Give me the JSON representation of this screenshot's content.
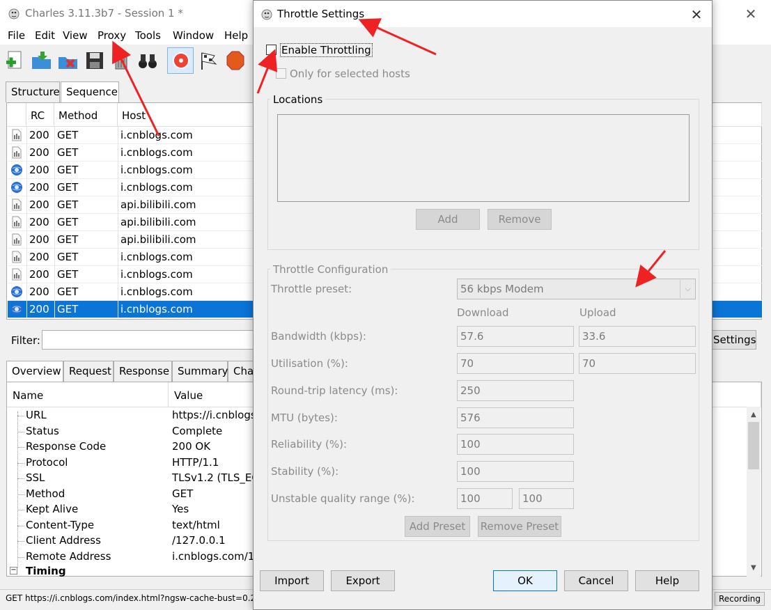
{
  "app": {
    "title": "Charles 3.11.3b7 - Session 1 *",
    "menu": [
      "File",
      "Edit",
      "View",
      "Proxy",
      "Tools",
      "Window",
      "Help"
    ],
    "tabs": [
      "Structure",
      "Sequence"
    ],
    "columns": [
      "RC",
      "Method",
      "Host"
    ],
    "rows": [
      {
        "rc": "200",
        "method": "GET",
        "host": "i.cnblogs.com",
        "icon": "page-icon"
      },
      {
        "rc": "200",
        "method": "GET",
        "host": "i.cnblogs.com",
        "icon": "page-icon"
      },
      {
        "rc": "200",
        "method": "GET",
        "host": "i.cnblogs.com",
        "icon": "globe-icon"
      },
      {
        "rc": "200",
        "method": "GET",
        "host": "i.cnblogs.com",
        "icon": "globe-icon"
      },
      {
        "rc": "200",
        "method": "GET",
        "host": "api.bilibili.com",
        "icon": "page-icon"
      },
      {
        "rc": "200",
        "method": "GET",
        "host": "api.bilibili.com",
        "icon": "page-icon"
      },
      {
        "rc": "200",
        "method": "GET",
        "host": "api.bilibili.com",
        "icon": "page-icon"
      },
      {
        "rc": "200",
        "method": "GET",
        "host": "i.cnblogs.com",
        "icon": "page-icon"
      },
      {
        "rc": "200",
        "method": "GET",
        "host": "i.cnblogs.com",
        "icon": "page-icon"
      },
      {
        "rc": "200",
        "method": "GET",
        "host": "i.cnblogs.com",
        "icon": "globe-icon"
      },
      {
        "rc": "200",
        "method": "GET",
        "host": "i.cnblogs.com",
        "icon": "globe-icon"
      }
    ],
    "filter_label": "Filter:",
    "settings_label": "Settings",
    "detail_tabs": [
      "Overview",
      "Request",
      "Response",
      "Summary",
      "Cha"
    ],
    "detail_columns": [
      "Name",
      "Value"
    ],
    "detail_rows": [
      {
        "name": "URL",
        "value": "https://i.cnblogs"
      },
      {
        "name": "Status",
        "value": "Complete"
      },
      {
        "name": "Response Code",
        "value": "200 OK"
      },
      {
        "name": "Protocol",
        "value": "HTTP/1.1"
      },
      {
        "name": "SSL",
        "value": "TLSv1.2 (TLS_ECI"
      },
      {
        "name": "Method",
        "value": "GET"
      },
      {
        "name": "Kept Alive",
        "value": "Yes"
      },
      {
        "name": "Content-Type",
        "value": "text/html"
      },
      {
        "name": "Client Address",
        "value": "/127.0.0.1"
      },
      {
        "name": "Remote Address",
        "value": "i.cnblogs.com/1"
      }
    ],
    "timing_label": "Timing",
    "status_text": "GET https://i.cnblogs.com/index.html?ngsw-cache-bust=0.2",
    "recording_label": "Recording"
  },
  "dialog": {
    "title": "Throttle Settings",
    "enable_throttling": "Enable Throttling",
    "only_selected_hosts": "Only for selected hosts",
    "locations_label": "Locations",
    "add_label": "Add",
    "remove_label": "Remove",
    "config_label": "Throttle Configuration",
    "preset_label": "Throttle preset:",
    "preset_value": "56 kbps Modem",
    "download_label": "Download",
    "upload_label": "Upload",
    "bandwidth_label": "Bandwidth (kbps):",
    "bandwidth_download": "57.6",
    "bandwidth_upload": "33.6",
    "utilisation_label": "Utilisation (%):",
    "utilisation_download": "70",
    "utilisation_upload": "70",
    "latency_label": "Round-trip latency (ms):",
    "latency_value": "250",
    "mtu_label": "MTU (bytes):",
    "mtu_value": "576",
    "reliability_label": "Reliability (%):",
    "reliability_value": "100",
    "stability_label": "Stability (%):",
    "stability_value": "100",
    "unstable_label": "Unstable quality range (%):",
    "unstable_min": "100",
    "unstable_max": "100",
    "add_preset_label": "Add Preset",
    "remove_preset_label": "Remove Preset",
    "import_label": "Import",
    "export_label": "Export",
    "ok_label": "OK",
    "cancel_label": "Cancel",
    "help_label": "Help"
  },
  "colors": {
    "selection": "#0a74d7",
    "annotation": "#ee2222",
    "accent": "#0078d7"
  }
}
